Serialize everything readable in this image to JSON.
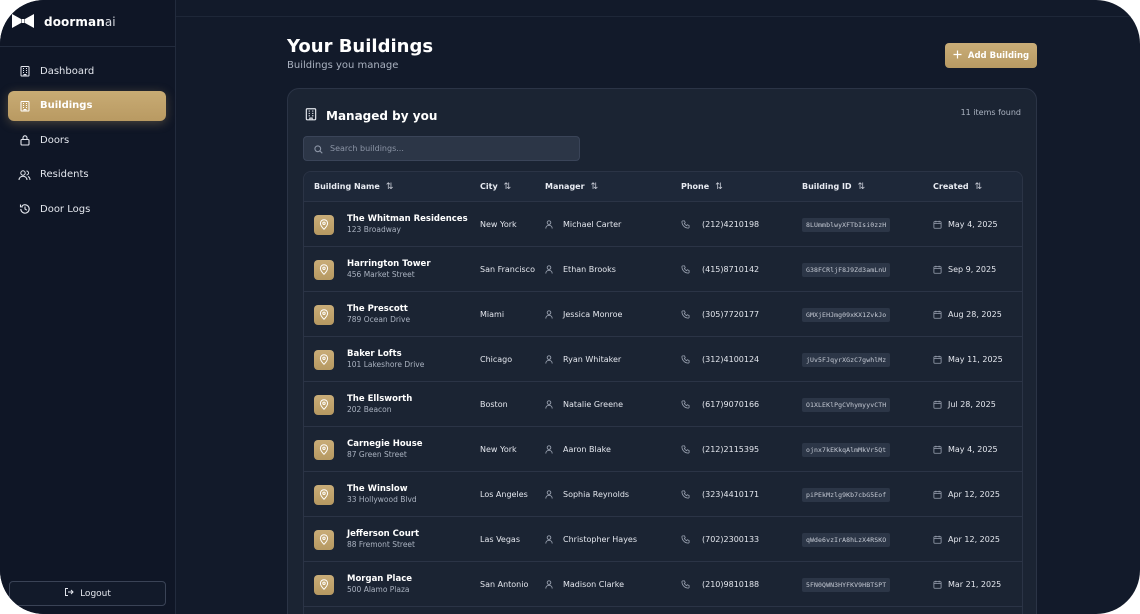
{
  "brand": {
    "name": "doorman",
    "suffix": "ai"
  },
  "sidebar": {
    "items": [
      {
        "label": "Dashboard",
        "icon": "building-icon",
        "active": false
      },
      {
        "label": "Buildings",
        "icon": "building-icon",
        "active": true
      },
      {
        "label": "Doors",
        "icon": "lock-icon",
        "active": false
      },
      {
        "label": "Residents",
        "icon": "users-icon",
        "active": false
      },
      {
        "label": "Door Logs",
        "icon": "history-icon",
        "active": false
      }
    ],
    "logout_label": "Logout"
  },
  "header": {
    "title": "Your Buildings",
    "subtitle": "Buildings you manage",
    "add_button_label": "Add Building"
  },
  "card": {
    "title": "Managed by you",
    "items_found": "11 items found",
    "search_placeholder": "Search buildings..."
  },
  "table": {
    "columns": [
      "Building Name",
      "City",
      "Manager",
      "Phone",
      "Building ID",
      "Created"
    ],
    "rows": [
      {
        "name": "The Whitman Residences",
        "address": "123 Broadway",
        "city": "New York",
        "manager": "Michael Carter",
        "phone": "(212)4210198",
        "id": "8LUmmblwyXFTbIsi0zzH",
        "created": "May 4, 2025"
      },
      {
        "name": "Harrington Tower",
        "address": "456 Market Street",
        "city": "San Francisco",
        "manager": "Ethan Brooks",
        "phone": "(415)8710142",
        "id": "G38FCRljF8J9Zd3amLnU",
        "created": "Sep 9, 2025"
      },
      {
        "name": "The Prescott",
        "address": "789 Ocean Drive",
        "city": "Miami",
        "manager": "Jessica Monroe",
        "phone": "(305)7720177",
        "id": "GMXjEHJmg09xKX1ZvkJo",
        "created": "Aug 28, 2025"
      },
      {
        "name": "Baker Lofts",
        "address": "101 Lakeshore Drive",
        "city": "Chicago",
        "manager": "Ryan Whitaker",
        "phone": "(312)4100124",
        "id": "jUv5FJqyrXGzC7gwhlMz",
        "created": "May 11, 2025"
      },
      {
        "name": "The Ellsworth",
        "address": "202 Beacon",
        "city": "Boston",
        "manager": "Natalie Greene",
        "phone": "(617)9070166",
        "id": "O1XLEKlPgCVhymyyvCTH",
        "created": "Jul 28, 2025"
      },
      {
        "name": "Carnegie House",
        "address": "87 Green Street",
        "city": "New York",
        "manager": "Aaron Blake",
        "phone": "(212)2115395",
        "id": "ojnx7kEKkqAlmMkVr5Qt",
        "created": "May 4, 2025"
      },
      {
        "name": "The Winslow",
        "address": "33 Hollywood Blvd",
        "city": "Los Angeles",
        "manager": "Sophia Reynolds",
        "phone": "(323)4410171",
        "id": "piPEkMzlg9Kb7cbG5Eof",
        "created": "Apr 12, 2025"
      },
      {
        "name": "Jefferson Court",
        "address": "88 Fremont Street",
        "city": "Las Vegas",
        "manager": "Christopher Hayes",
        "phone": "(702)2300133",
        "id": "qWde6vzIrA8hLzX4RSKO",
        "created": "Apr 12, 2025"
      },
      {
        "name": "Morgan Place",
        "address": "500 Alamo Plaza",
        "city": "San Antonio",
        "manager": "Madison Clarke",
        "phone": "(210)9810188",
        "id": "5FN0QWN3HYFKV9HBTSPT",
        "created": "Mar 21, 2025"
      }
    ]
  },
  "colors": {
    "accent": "#c3a56c",
    "background": "#121a2a",
    "sidebar": "#0f1626",
    "card": "#1b2433"
  }
}
